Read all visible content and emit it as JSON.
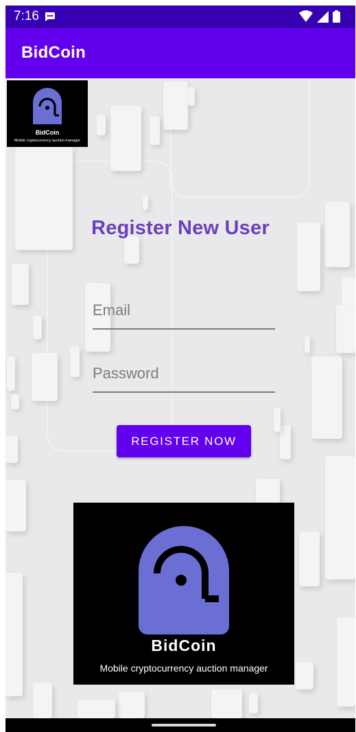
{
  "status_bar": {
    "time": "7:16",
    "icons": [
      "message-notification-icon",
      "wifi-icon",
      "cellular-signal-icon",
      "battery-icon"
    ]
  },
  "app_bar": {
    "title": "BidCoin"
  },
  "header_logo": {
    "name": "BidCoin",
    "tagline": "Mobile cryptocurrency auction manager"
  },
  "form": {
    "title": "Register New User",
    "email": {
      "placeholder": "Email",
      "value": ""
    },
    "password": {
      "placeholder": "Password",
      "value": ""
    },
    "submit_label": "REGISTER NOW"
  },
  "footer_logo": {
    "name": "BidCoin",
    "tagline": "Mobile cryptocurrency auction manager"
  },
  "colors": {
    "status_bar": "#3700b3",
    "app_bar": "#6200ee",
    "title_text": "#6a3fc1",
    "button": "#6200ee",
    "logo_mark": "#6b6fd3"
  }
}
